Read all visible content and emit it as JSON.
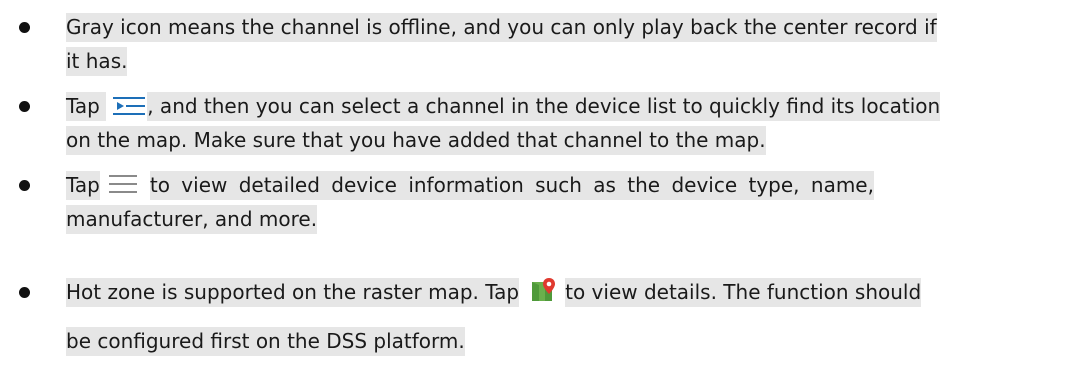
{
  "bullets": [
    {
      "lines": [
        "Gray icon means the channel is offline, and you can only play back the center record if",
        "it has."
      ]
    },
    {
      "before_icon": "Tap ",
      "icon": "channel-locate-icon",
      "after_icon": ", and then you can select a channel in the device list to quickly find its location",
      "line2": "on the map. Make sure that you have added that channel to the map."
    },
    {
      "before_icon": "Tap",
      "icon": "menu-lines-icon",
      "after_icon": "to view detailed device information such as the device type, name,",
      "line2": "manufacturer, and more."
    },
    {
      "before_icon": "Hot zone is supported on the raster map. Tap",
      "icon": "raster-map-pin-icon",
      "after_icon": "to view details. The function should",
      "line2": "be configured first on the DSS platform."
    }
  ],
  "colors": {
    "highlight": "#e6e6e6",
    "text": "#1a1a1a",
    "icon_blue": "#1d6fb8",
    "map_green": "#6ab04c",
    "pin_red": "#e03a2f"
  }
}
